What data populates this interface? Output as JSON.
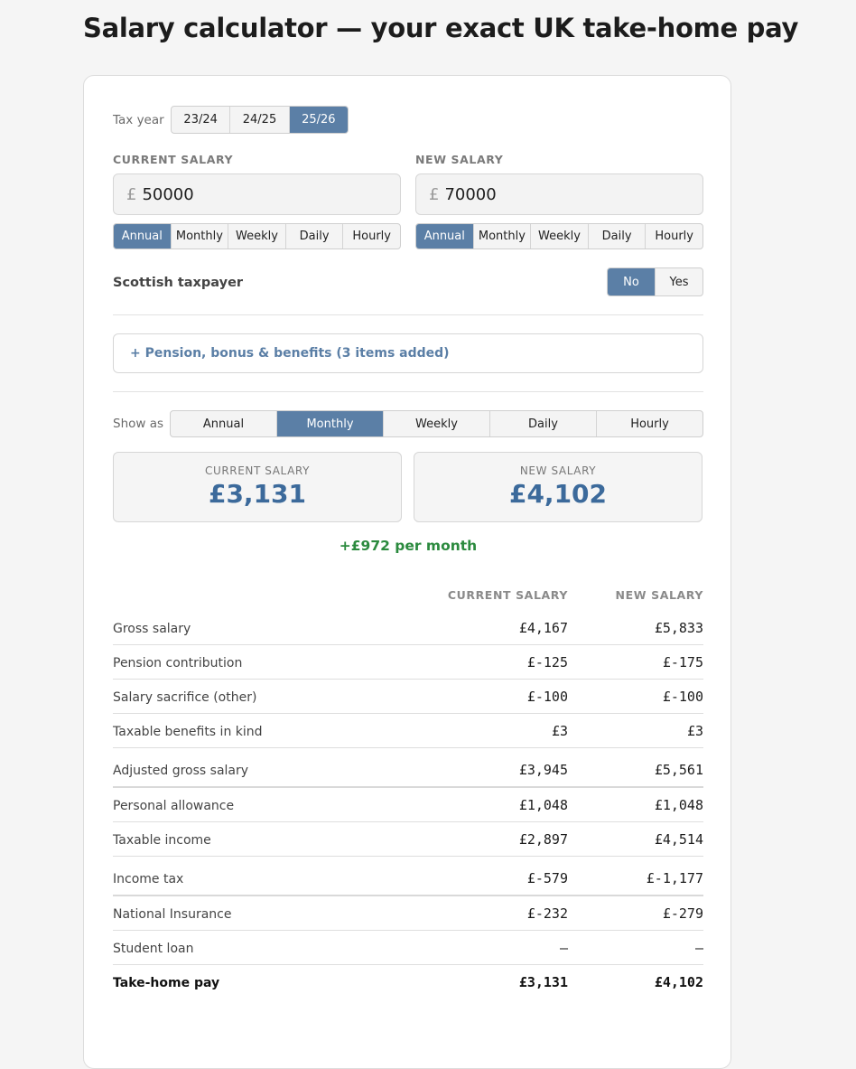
{
  "page_title": "Salary calculator — your exact UK take-home pay",
  "tax_year": {
    "label": "Tax year",
    "options": [
      "23/24",
      "24/25",
      "25/26"
    ],
    "selected": "25/26"
  },
  "current_salary": {
    "label": "CURRENT SALARY",
    "currency": "£",
    "value": "50000",
    "period_options": [
      "Annual",
      "Monthly",
      "Weekly",
      "Daily",
      "Hourly"
    ],
    "period_selected": "Annual"
  },
  "new_salary": {
    "label": "NEW SALARY",
    "currency": "£",
    "value": "70000",
    "period_options": [
      "Annual",
      "Monthly",
      "Weekly",
      "Daily",
      "Hourly"
    ],
    "period_selected": "Annual"
  },
  "scottish": {
    "label": "Scottish taxpayer",
    "options": [
      "No",
      "Yes"
    ],
    "selected": "No"
  },
  "extras": {
    "label": "+ Pension, bonus & benefits (3 items added)"
  },
  "show_as": {
    "label": "Show as",
    "options": [
      "Annual",
      "Monthly",
      "Weekly",
      "Daily",
      "Hourly"
    ],
    "selected": "Monthly"
  },
  "results": {
    "current_label": "CURRENT SALARY",
    "current_amount": "£3,131",
    "new_label": "NEW SALARY",
    "new_amount": "£4,102",
    "difference": "+£972 per month"
  },
  "breakdown": {
    "headers": [
      "CURRENT SALARY",
      "NEW SALARY"
    ],
    "rows": [
      {
        "label": "Gross salary",
        "current": "£4,167",
        "new": "£5,833"
      },
      {
        "label": "Pension contribution",
        "current": "£-125",
        "new": "£-175"
      },
      {
        "label": "Salary sacrifice (other)",
        "current": "£-100",
        "new": "£-100"
      },
      {
        "label": "Taxable benefits in kind",
        "current": "£3",
        "new": "£3"
      },
      {
        "label": "Adjusted gross salary",
        "current": "£3,945",
        "new": "£5,561"
      },
      {
        "label": "Personal allowance",
        "current": "£1,048",
        "new": "£1,048"
      },
      {
        "label": "Taxable income",
        "current": "£2,897",
        "new": "£4,514"
      },
      {
        "label": "Income tax",
        "current": "£-579",
        "new": "£-1,177"
      },
      {
        "label": "National Insurance",
        "current": "£-232",
        "new": "£-279"
      },
      {
        "label": "Student loan",
        "current": "—",
        "new": "—"
      },
      {
        "label": "Take-home pay",
        "current": "£3,131",
        "new": "£4,102"
      }
    ]
  }
}
